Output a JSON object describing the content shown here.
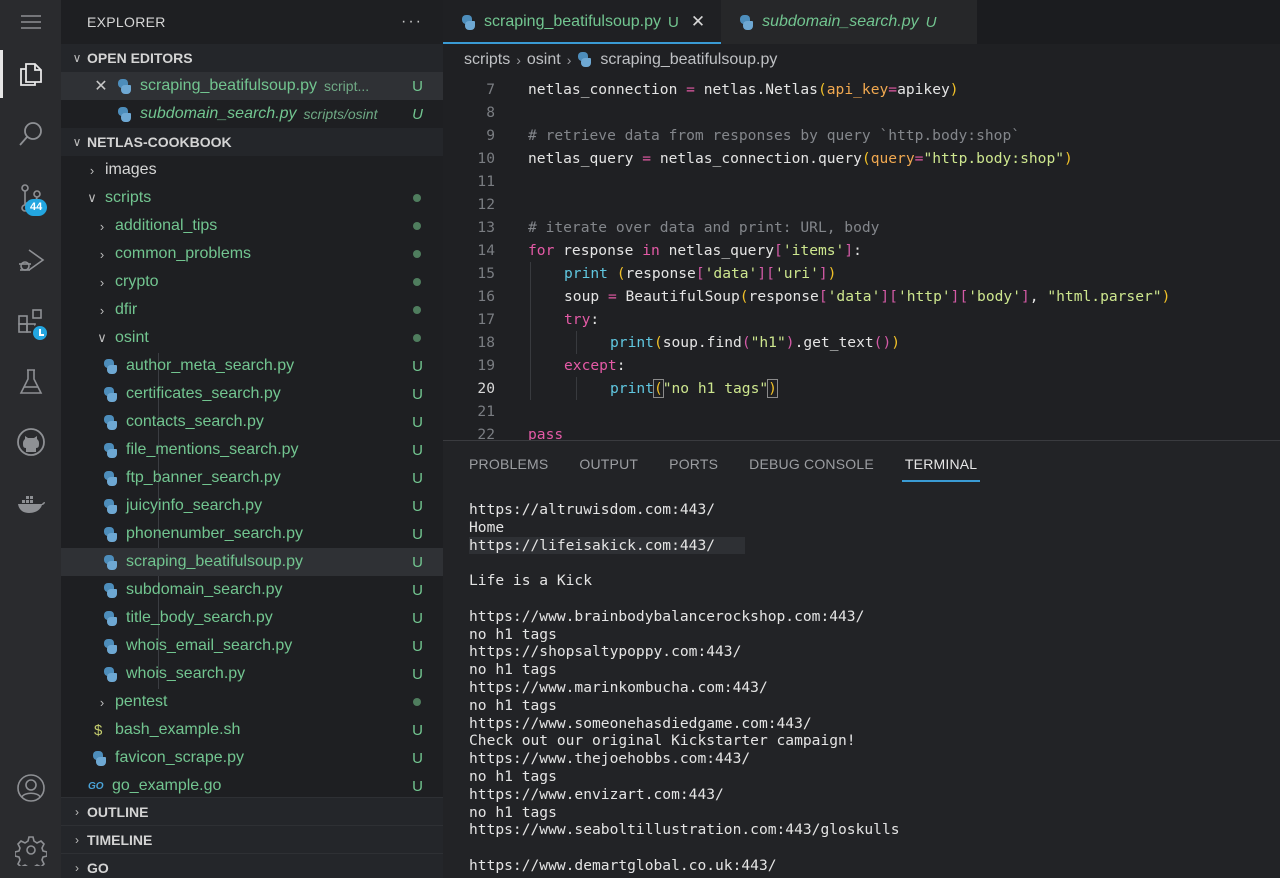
{
  "activity_bar": {
    "items": [
      {
        "icon": "menu-icon"
      },
      {
        "icon": "files-icon",
        "active": true
      },
      {
        "icon": "search-icon"
      },
      {
        "icon": "source-control-icon",
        "badge": "44"
      },
      {
        "icon": "run-debug-icon"
      },
      {
        "icon": "extensions-icon"
      },
      {
        "icon": "testing-icon"
      },
      {
        "icon": "github-icon"
      },
      {
        "icon": "docker-icon"
      },
      {
        "icon": "account-icon"
      },
      {
        "icon": "settings-gear-icon"
      }
    ]
  },
  "sidebar": {
    "title": "EXPLORER",
    "more": "···",
    "open_editors": {
      "title": "OPEN EDITORS",
      "items": [
        {
          "name": "scraping_beatifulsoup.py",
          "desc": "script...",
          "status": "U"
        },
        {
          "name": "subdomain_search.py",
          "desc": "scripts/osint",
          "status": "U"
        }
      ]
    },
    "workspace": {
      "title": "NETLAS-COOKBOOK",
      "images": "images",
      "scripts": "scripts",
      "folders": [
        "additional_tips",
        "common_problems",
        "crypto",
        "dfir"
      ],
      "osint": "osint",
      "osint_files": [
        "author_meta_search.py",
        "certificates_search.py",
        "contacts_search.py",
        "file_mentions_search.py",
        "ftp_banner_search.py",
        "juicyinfo_search.py",
        "phonenumber_search.py",
        "scraping_beatifulsoup.py",
        "subdomain_search.py",
        "title_body_search.py",
        "whois_email_search.py",
        "whois_search.py"
      ],
      "pentest": "pentest",
      "bash_file": "bash_example.sh",
      "favicon_file": "favicon_scrape.py",
      "go_file": "go_example.go",
      "status_u": "U",
      "go_icon_text": "GO",
      "bash_icon_text": "$"
    },
    "outline": "OUTLINE",
    "timeline": "TIMELINE",
    "go": "GO"
  },
  "editor": {
    "tabs": [
      {
        "label": "scraping_beatifulsoup.py",
        "status": "U",
        "active": true
      },
      {
        "label": "subdomain_search.py",
        "status": "U",
        "active": false
      }
    ],
    "breadcrumb": [
      "scripts",
      "osint",
      "scraping_beatifulsoup.py"
    ],
    "current_line": 20,
    "lines": [
      {
        "n": "7"
      },
      {
        "n": "8"
      },
      {
        "n": "9"
      },
      {
        "n": "10"
      },
      {
        "n": "11"
      },
      {
        "n": "12"
      },
      {
        "n": "13"
      },
      {
        "n": "14"
      },
      {
        "n": "15"
      },
      {
        "n": "16"
      },
      {
        "n": "17"
      },
      {
        "n": "18"
      },
      {
        "n": "19"
      },
      {
        "n": "20"
      },
      {
        "n": "21"
      },
      {
        "n": "22"
      }
    ],
    "code": {
      "l7": [
        "netlas_connection ",
        "=",
        " netlas.Netlas",
        "(",
        "api_key",
        "=",
        "apikey",
        ")"
      ],
      "l9": "# retrieve data from responses by query `http.body:shop`",
      "l10": [
        "netlas_query ",
        "=",
        " netlas_connection.query",
        "(",
        "query",
        "=",
        "\"http.body:shop\"",
        ")"
      ],
      "l13": "# iterate over data and print: URL, body",
      "l14": [
        "for",
        " response ",
        "in",
        " netlas_query",
        "[",
        "'items'",
        "]",
        ":"
      ],
      "l15": [
        "print",
        " ",
        "(",
        "response",
        "[",
        "'data'",
        "]",
        "[",
        "'uri'",
        "]",
        ")"
      ],
      "l16": [
        "soup ",
        "=",
        " BeautifulSoup",
        "(",
        "response",
        "[",
        "'data'",
        "]",
        "[",
        "'http'",
        "]",
        "[",
        "'body'",
        "]",
        ", ",
        "\"html.parser\"",
        ")"
      ],
      "l17": [
        "try",
        ":"
      ],
      "l18": [
        "print",
        "(",
        "soup.find",
        "(",
        "\"h1\"",
        ")",
        ".get_text",
        "(",
        ")",
        ")"
      ],
      "l19": [
        "except",
        ":"
      ],
      "l20": [
        "print",
        "(",
        "\"no h1 tags\"",
        ")"
      ],
      "l22": "pass"
    }
  },
  "panel": {
    "tabs": [
      "PROBLEMS",
      "OUTPUT",
      "PORTS",
      "DEBUG CONSOLE",
      "TERMINAL"
    ],
    "active_tab": "TERMINAL",
    "terminal_lines": [
      "https://altruwisdom.com:443/",
      "Home",
      "https://lifeisakick.com:443/",
      "",
      "Life is a Kick",
      "",
      "https://www.brainbodybalancerockshop.com:443/",
      "no h1 tags",
      "https://shopsaltypoppy.com:443/",
      "no h1 tags",
      "https://www.marinkombucha.com:443/",
      "no h1 tags",
      "https://www.someonehasdiedgame.com:443/",
      "Check out our original Kickstarter campaign!",
      "https://www.thejoehobbs.com:443/",
      "no h1 tags",
      "https://www.envizart.com:443/",
      "no h1 tags",
      "https://www.seaboltillustration.com:443/gloskulls",
      "",
      "https://www.demartglobal.co.uk:443/"
    ]
  }
}
